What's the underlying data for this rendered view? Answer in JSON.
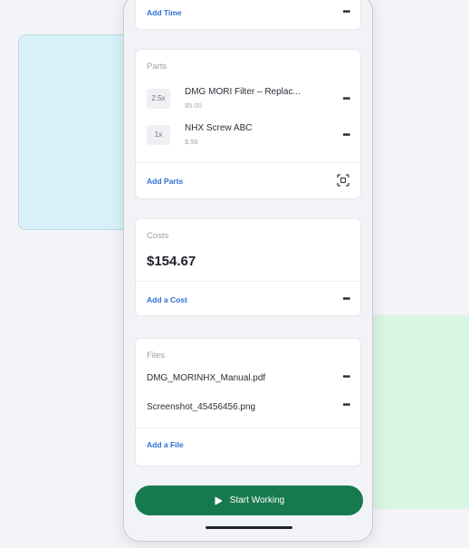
{
  "time_card": {
    "add_label": "Add Time"
  },
  "parts": {
    "title": "Parts",
    "items": [
      {
        "qty": "2.5x",
        "name": "DMG MORI Filter – Replac...",
        "price": "$5.00"
      },
      {
        "qty": "1x",
        "name": "NHX Screw ABC",
        "price": "$.99"
      }
    ],
    "add_label": "Add Parts",
    "scan_icon": "scan-icon"
  },
  "costs": {
    "title": "Costs",
    "total": "$154.67",
    "add_label": "Add a Cost"
  },
  "files": {
    "title": "Files",
    "items": [
      {
        "name": "DMG_MORINHX_Manual.pdf"
      },
      {
        "name": "Screenshot_45456456.png"
      }
    ],
    "add_label": "Add a File"
  },
  "action": {
    "label": "Start Working",
    "icon": "play-icon"
  },
  "colors": {
    "primary_green": "#177a4e",
    "link_blue": "#2f6fd6",
    "bg_blue": "#d8f1f8",
    "bg_green": "#d9f5e3"
  }
}
